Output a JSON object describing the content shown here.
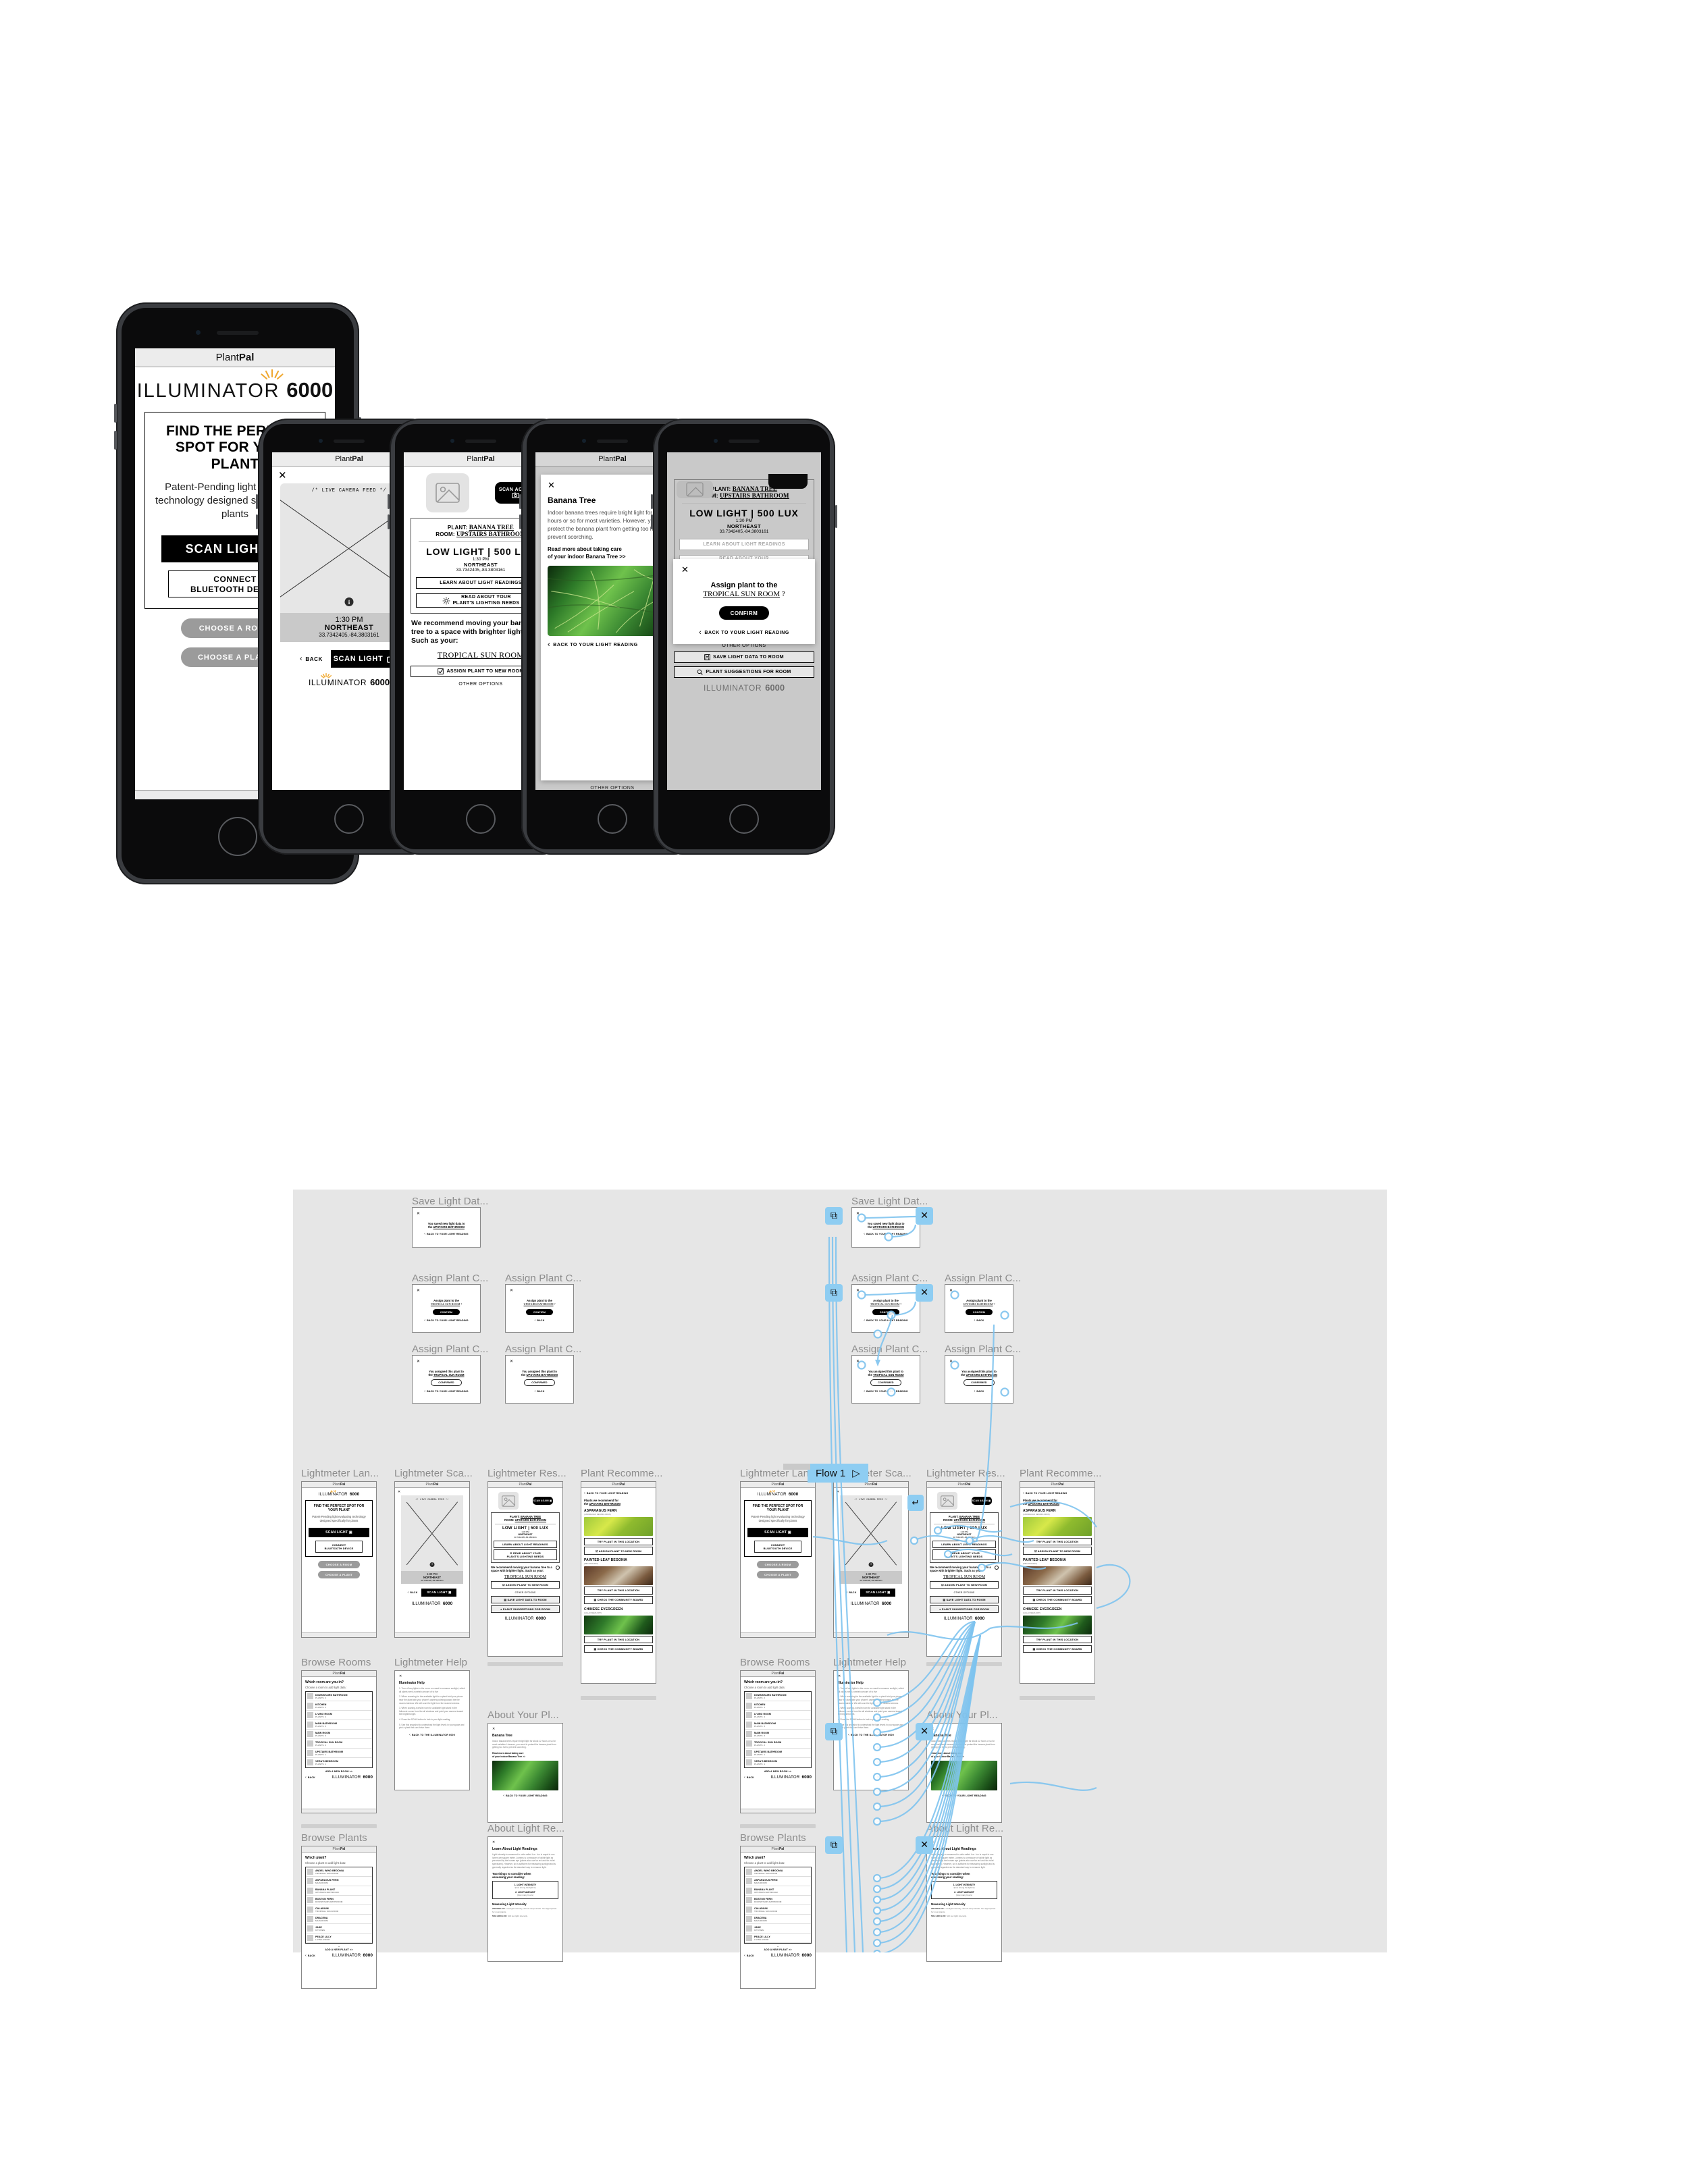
{
  "app": {
    "name_light": "Plant",
    "name_bold": "Pal"
  },
  "brand": {
    "word": "ILLUMINATOR",
    "num": "6000",
    "rays": "☀"
  },
  "screen_landing": {
    "headline": "FIND THE PERFECT SPOT FOR YOUR PLANT",
    "subtext": "Patent-Pending light evaluating technology designed specifically for plants",
    "scan_button": "SCAN LIGHT",
    "bluetooth_line1": "CONNECT",
    "bluetooth_line2": "BLUETOOTH DEVICE",
    "choose_room": "CHOOSE A ROOM",
    "choose_plant": "CHOOSE A PLANT"
  },
  "screen_scan": {
    "close": "✕",
    "feed_label": "/* LIVE CAMERA FEED */",
    "info_icon": "i",
    "time": "1:30 PM",
    "direction": "NORTHEAST",
    "coords": "33.7342405,-84.3803161",
    "back": "BACK",
    "scan_button": "SCAN LIGHT"
  },
  "screen_result": {
    "scan_again": "SCAN AGAIN",
    "plant_label": "PLANT:",
    "plant_value": "BANANA TREE",
    "room_label": "ROOM:",
    "room_value": "UPSTAIRS BATHROOM",
    "lux": "LOW LIGHT | 500 LUX",
    "time": "1:30 PM",
    "direction": "NORTHEAST",
    "coords": "33.7342405,-84.3803161",
    "learn_button": "LEARN ABOUT LIGHT READINGS",
    "read_button_l1": "READ ABOUT YOUR",
    "read_button_l2": "PLANT'S LIGHTING NEEDS",
    "recommendation": "We recommend moving your banana tree to a space with brighter light. Such as your:",
    "room_link": "TROPICAL SUN ROOM",
    "assign_button": "ASSIGN PLANT TO NEW ROOM",
    "other_options": "OTHER OPTIONS",
    "save_button": "SAVE LIGHT DATA TO ROOM",
    "suggestions_button": "PLANT SUGGESTIONS FOR ROOM"
  },
  "screen_plant_info": {
    "close": "✕",
    "title": "Banana Tree",
    "body": "Indoor banana trees require bright light for about 12 hours or so for most varieties. However, you need to protect the banana plant from getting too hot to prevent scorching.",
    "read_more_l1": "Read more about taking care",
    "read_more_l2": "of your indoor Banana Tree >>",
    "back": "BACK TO YOUR LIGHT READING"
  },
  "screen_assign": {
    "close": "✕",
    "title_l1": "Assign plant to the",
    "room": "TROPICAL SUN ROOM",
    "qmark": "?",
    "confirm": "CONFIRM",
    "back": "BACK TO YOUR LIGHT READING"
  },
  "flow": {
    "flow_label": "Flow 1",
    "play_icon": "▷",
    "frames": {
      "save_light": "Save Light Dat...",
      "assign_plant": "Assign Plant C...",
      "lightmeter_landing": "Lightmeter Lan...",
      "lightmeter_scan": "Lightmeter Sca...",
      "lightmeter_result": "Lightmeter Res...",
      "plant_recommend": "Plant Recomme...",
      "browse_rooms": "Browse Rooms",
      "browse_plants": "Browse Plants",
      "lightmeter_help": "Lightmeter Help",
      "about_your_plant": "About Your Pl...",
      "about_light": "About Light Re..."
    },
    "saved_msg_l1": "You saved new light data to",
    "saved_msg_l2_prefix": "the ",
    "saved_msg_room": "UPSTAIRS BATHROOM",
    "assigned_msg_l1": "You assigned this plant to",
    "assigned_msg_prefix": "the ",
    "confirmed": "CONFIRMED",
    "back_light_reading": "BACK TO YOUR LIGHT READING",
    "back": "BACK",
    "room_tropical": "TROPICAL SUN ROOM",
    "room_upstairs": "UPSTAIRS BATHROOM"
  },
  "browse_rooms": {
    "question": "Which room are you in?",
    "hint": "Choose a room to add light data:",
    "add_new": "ADD A NEW ROOM >>",
    "back": "BACK",
    "rooms": [
      {
        "name": "DOWNSTAIRS BATHROOM",
        "sub": "PLANTS: 2"
      },
      {
        "name": "KITCHEN",
        "sub": "PLANTS: 1"
      },
      {
        "name": "LIVING ROOM",
        "sub": "PLANTS: 4"
      },
      {
        "name": "MAIN BATHROOM",
        "sub": "PLANTS: 3"
      },
      {
        "name": "MAIN ROOM",
        "sub": "PLANTS: 3"
      },
      {
        "name": "TROPICAL SUN ROOM",
        "sub": "PLANTS: 2"
      },
      {
        "name": "UPSTAIRS BATHROOM",
        "sub": "PLANTS: 1"
      },
      {
        "name": "VERA'S BEDROOM",
        "sub": "PLANTS: 1"
      }
    ]
  },
  "browse_plants": {
    "question": "Which plant?",
    "hint": "Choose a plant to add light data:",
    "add_new": "ADD A NEW PLANT >>",
    "back": "BACK",
    "plants": [
      {
        "name": "ANGEL WING BEGONIA",
        "sub": "TROPICAL SUN ROOM"
      },
      {
        "name": "ASPARAGUS FERN",
        "sub": "MAIN ROOM"
      },
      {
        "name": "BANANA PLANT",
        "sub": "UPSTAIRS BATHROOM"
      },
      {
        "name": "BOSTON FERN",
        "sub": "DOWNSTAIRS BATHROOM"
      },
      {
        "name": "CALADIUM",
        "sub": "TROPICAL SUN ROOM"
      },
      {
        "name": "DRACENA",
        "sub": "MAIN ROOM"
      },
      {
        "name": "JADE",
        "sub": "KITCHEN"
      },
      {
        "name": "PEACE LILLY",
        "sub": "LIVING ROOM"
      }
    ]
  },
  "plant_recommend": {
    "back": "BACK TO YOUR LIGHT READING",
    "heading_l1": "Plants we recommend for",
    "heading_l2_prefix": "the ",
    "heading_room": "UPSTAIRS BATHROOM",
    "try_button": "TRY PLANT IN THIS LOCATION",
    "assign_button": "ASSIGN PLANT TO NEW ROOM",
    "community_button": "CHECK THE COMMUNITY BOARD",
    "items": [
      {
        "name": "ASPARAGUS FERN",
        "latin": "(ASPARAGUS DENSIFLORUS)"
      },
      {
        "name": "PAINTED-LEAF BEGONIA",
        "latin": "(BEGONIA REX)"
      },
      {
        "name": "CHINESE EVERGREEN",
        "latin": "(AGLAONEMA SPP.)"
      }
    ]
  },
  "lightmeter_help": {
    "title": "Illuminator Help",
    "steps": [
      "1. Turn off any lights in the room- we want to measure sunlight, which all plants need a certain amount of to live",
      "2. When scanning for the available light for a plant hold your phone near the plant with your phone's camera pointing toward the the nearest window. We will scan the light from the nearest window.",
      "3. When scaning a whole room for available light stand in the futherest corner from the all windows and point your camera toward the brightest light.",
      "4. Press the SCAN button to lock in your light reading.",
      "5. Use this snapshot to understnad the light levels in your space and pick a plant that can thrive there."
    ],
    "back": "BACK TO THE ILLUMINATOR 6000"
  },
  "about_light": {
    "title": "Learn About Light Readings",
    "body": "Light intensity is measured in units called Lux. Lux is equal to one lumen per square meter. Lumens is a measure of visible light as perceived by the human eye (plants also use far red and far violet spectrums). However, lux is sufficient for measuring sunlight and is generally regarded as the standard way to measure light.",
    "consider_l1": "Two things to consider when",
    "consider_l2": "assessing your reading:",
    "factor1": "1. LIGHT INTENSITY",
    "factor1_sub": "(how strong the light is)",
    "factor2": "2. LIGHT AMOUNT",
    "factor2_sub": "(how many hours)",
    "measuring_title": "Measuring Light Intensity",
    "range1": "200-500 LUX:",
    "range1_text": "Low light intensity, almost deep shade. Not appropriate for most plants.",
    "range2": "500-1,000 LUX:",
    "range2_text": "Still low light intensity."
  },
  "colors": {
    "accent_blue": "#8ecdf2",
    "ray_orange": "#f0a830",
    "board_bg": "#e6e6e6",
    "appbar_bg": "#ececec"
  }
}
